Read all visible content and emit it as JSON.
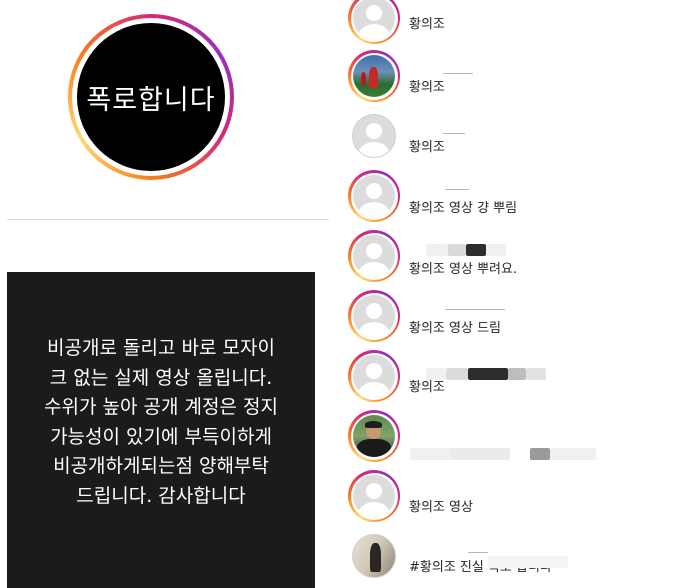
{
  "profile": {
    "avatar_text": "폭로합니다"
  },
  "notice": {
    "text": "비공개로 돌리고 바로 모자이\n크 없는 실제 영상 올립니다.\n수위가 높아 공개 계정은 정지\n가능성이 있기에 부득이하게\n비공개하게되는점 양해부탁\n드립니다. 감사합니다"
  },
  "list": {
    "items": [
      {
        "label": "황의조",
        "avatar": "default-profile-icon",
        "ring": true
      },
      {
        "label": "황의조",
        "avatar": "soccer-player-photo",
        "ring": true
      },
      {
        "label": "황의조",
        "avatar": "default-profile-icon",
        "ring": false
      },
      {
        "label": "황의조 영상 걍 뿌림",
        "avatar": "default-profile-icon",
        "ring": true
      },
      {
        "label": "황의조 영상 뿌려요.",
        "avatar": "default-profile-icon",
        "ring": true
      },
      {
        "label": "황의조 영상 드림",
        "avatar": "default-profile-icon",
        "ring": true
      },
      {
        "label": "황의조",
        "avatar": "default-profile-icon",
        "ring": true
      },
      {
        "label": "",
        "avatar": "coach-photo",
        "ring": true
      },
      {
        "label": "황의조 영상",
        "avatar": "default-profile-icon",
        "ring": true
      },
      {
        "label": "#황의조 진실 폭로 합니다",
        "avatar": "room-photo",
        "ring": false
      }
    ]
  }
}
